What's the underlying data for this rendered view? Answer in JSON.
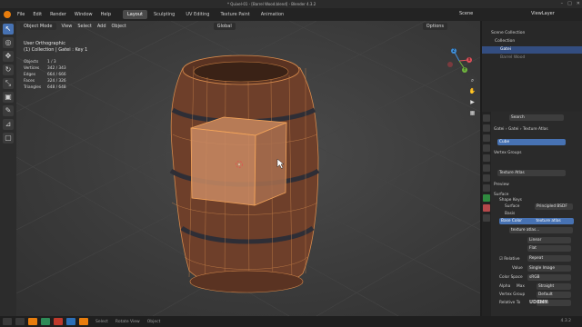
{
  "window": {
    "title": "* Quixel-01 - [Barrel Wood.blend] - Blender 4.3.2"
  },
  "menubar": {
    "items": [
      "File",
      "Edit",
      "Render",
      "Window",
      "Help"
    ],
    "workspaces": [
      "Layout",
      "Sculpting",
      "UV Editing",
      "Texture Paint",
      "Animation"
    ],
    "active_workspace": "Layout",
    "scene": "Scene",
    "view_layer": "ViewLayer"
  },
  "viewport_header": {
    "mode": "Object Mode",
    "menus": [
      "View",
      "Select",
      "Add",
      "Object"
    ],
    "orientation": "Global",
    "options": "Options"
  },
  "viewport": {
    "view_name": "User Orthographic",
    "collection_info": "(1) Collection | Gatei : Key 1",
    "stats": [
      {
        "label": "Objects",
        "value": "1 / 3"
      },
      {
        "label": "Vertices",
        "value": "342 / 343"
      },
      {
        "label": "Edges",
        "value": "664 / 666"
      },
      {
        "label": "Faces",
        "value": "324 / 326"
      },
      {
        "label": "Triangles",
        "value": "648 / 648"
      }
    ]
  },
  "gizmo": {
    "x": "X",
    "y": "Y",
    "z": "Z"
  },
  "outliner": {
    "root": "Scene Collection",
    "collection": "Collection",
    "rows": [
      "Gatei",
      "Barrel Wood"
    ]
  },
  "properties": {
    "search_placeholder": "Search",
    "breadcrumb": [
      "Gatei",
      "Gatei",
      "Texture Atlas"
    ],
    "material_slot": "Cube",
    "vertex_groups": "Vertex Groups",
    "texture_atlas": "Texture Atlas",
    "preview": "Preview",
    "surface": "Surface",
    "shape_keys": "Shape Keys",
    "surface_value": "Principled BSDF",
    "basis": "Basis",
    "base_color": "Base Color",
    "base_color_value": "texture atlas",
    "texture_atlas_2": "texture atlas...",
    "linear": "Linear",
    "flat": "Flat",
    "relative": "Relative",
    "repeat": "Repeat",
    "value": "Value",
    "single_image": "Single Image",
    "color_space": "Color Space",
    "color_space_value": "sRGB",
    "alpha": "Alpha",
    "alpha_value": "Straight",
    "vertex_group": "Vertex Group",
    "max": "Max",
    "relative_to": "Relative To",
    "default": "Default",
    "basis2": "Basis"
  },
  "statusbar": {
    "left": "Select",
    "mid": "Rotate View",
    "right": "Object",
    "version": "4.3.2"
  },
  "watermark": "UDEMY"
}
